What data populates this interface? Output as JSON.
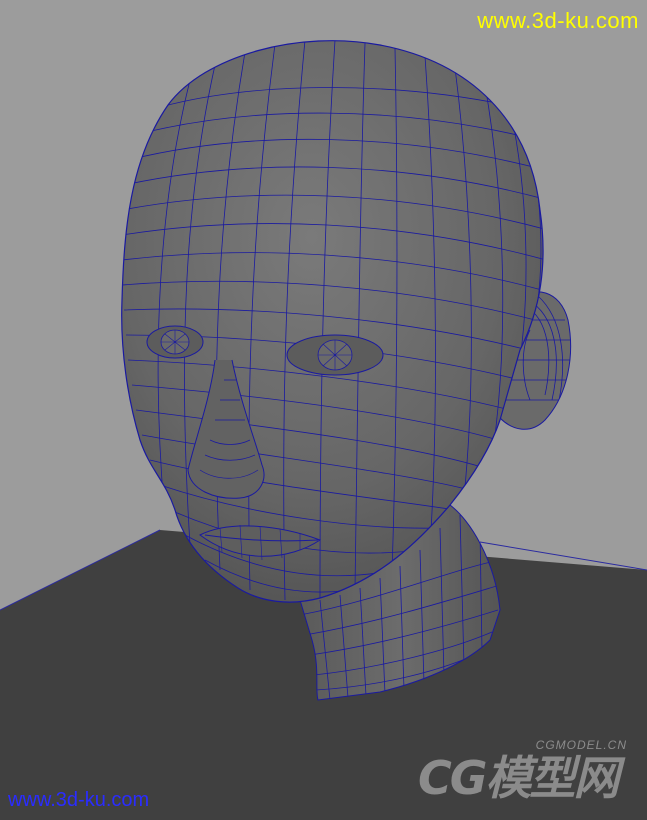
{
  "watermark_top": "www.3d-ku.com",
  "watermark_bottom": "www.3d-ku.com",
  "logo": {
    "small_text": "CGMODEL.CN",
    "big_text": "CG模型网"
  },
  "colors": {
    "background": "#9c9c9c",
    "floor": "#404040",
    "mesh_fill": "#6e6e6e",
    "wireframe": "#1a1aa0",
    "watermark_top": "#ffff00",
    "watermark_bottom": "#2a2cff"
  }
}
